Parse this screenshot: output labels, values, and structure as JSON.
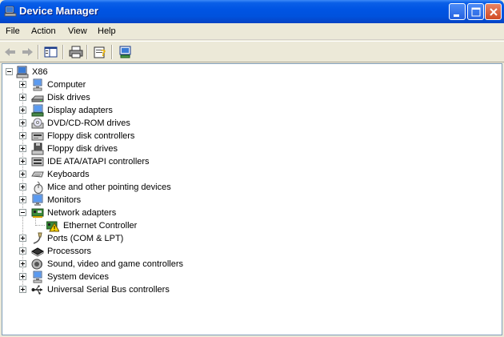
{
  "window": {
    "title": "Device Manager"
  },
  "menu": {
    "items": [
      "File",
      "Action",
      "View",
      "Help"
    ]
  },
  "tree": {
    "root": "X86",
    "items": [
      {
        "label": "Computer",
        "icon": "computer-icon"
      },
      {
        "label": "Disk drives",
        "icon": "disk-drive-icon"
      },
      {
        "label": "Display adapters",
        "icon": "display-adapter-icon"
      },
      {
        "label": "DVD/CD-ROM drives",
        "icon": "cdrom-icon"
      },
      {
        "label": "Floppy disk controllers",
        "icon": "floppy-controller-icon"
      },
      {
        "label": "Floppy disk drives",
        "icon": "floppy-drive-icon"
      },
      {
        "label": "IDE ATA/ATAPI controllers",
        "icon": "ide-controller-icon"
      },
      {
        "label": "Keyboards",
        "icon": "keyboard-icon"
      },
      {
        "label": "Mice and other pointing devices",
        "icon": "mouse-icon"
      },
      {
        "label": "Monitors",
        "icon": "monitor-icon"
      },
      {
        "label": "Network adapters",
        "icon": "network-adapter-icon",
        "expanded": true
      },
      {
        "label": "Ethernet Controller",
        "icon": "warning-network-icon",
        "child": true
      },
      {
        "label": "Ports (COM & LPT)",
        "icon": "port-icon"
      },
      {
        "label": "Processors",
        "icon": "processor-icon"
      },
      {
        "label": "Sound, video and game controllers",
        "icon": "sound-icon"
      },
      {
        "label": "System devices",
        "icon": "system-device-icon"
      },
      {
        "label": "Universal Serial Bus controllers",
        "icon": "usb-icon"
      }
    ]
  },
  "colors": {
    "titlebar": "#0054e3",
    "chrome": "#ece9d8",
    "tree_border": "#7f9db9"
  }
}
